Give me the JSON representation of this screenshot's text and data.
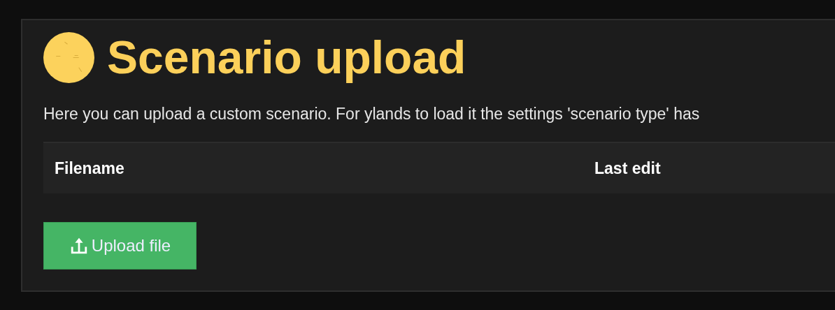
{
  "title": "Scenario upload",
  "description": "Here you can upload a custom scenario. For ylands to load it the settings 'scenario type' has",
  "table": {
    "columns": [
      "Filename",
      "Last edit"
    ]
  },
  "upload_button": {
    "label": "Upload file"
  }
}
